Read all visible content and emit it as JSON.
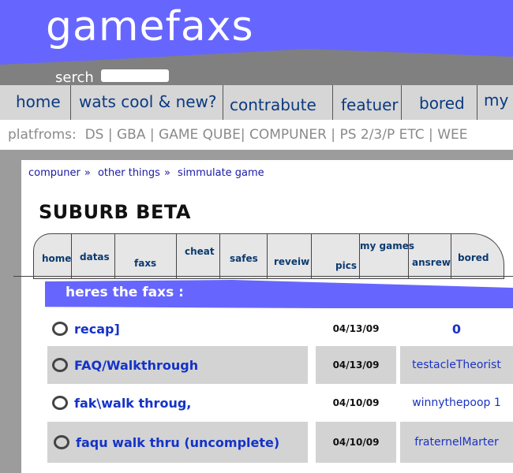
{
  "site": {
    "logo": "gamefaxs",
    "search_label": "serch",
    "search_value": ""
  },
  "nav": {
    "items": [
      {
        "label": "home"
      },
      {
        "label": "wats cool & new?"
      },
      {
        "label": "contrabute"
      },
      {
        "label": "featuer"
      },
      {
        "label": "bored"
      },
      {
        "label": "my"
      }
    ]
  },
  "platforms": {
    "label": "platfroms:",
    "items": [
      "DS",
      "GBA",
      "GAME QUBE",
      "COMPUNER",
      "PS 2/3/P ETC",
      "WEE"
    ]
  },
  "breadcrumb": {
    "items": [
      "compuner",
      "other things",
      "simmulate game"
    ],
    "separator": "»"
  },
  "game": {
    "title": "SUBURB BETA"
  },
  "tabs": [
    {
      "label": "home"
    },
    {
      "label": "datas"
    },
    {
      "label": "faxs"
    },
    {
      "label": "cheat"
    },
    {
      "label": "safes"
    },
    {
      "label": "reveiw"
    },
    {
      "label": "pics"
    },
    {
      "label": "my games"
    },
    {
      "label": "ansrew"
    },
    {
      "label": "bored"
    }
  ],
  "faxs_section": {
    "heading": "heres the faxs  :"
  },
  "faqs": [
    {
      "title": "recap]",
      "date": "04/13/09",
      "author": "0"
    },
    {
      "title": "FAQ/Walkthrough",
      "date": "04/13/09",
      "author": "testacleTheorist"
    },
    {
      "title": "fak\\walk throug,",
      "date": "04/10/09",
      "author": "winnythepoop 1"
    },
    {
      "title": "faqu walk thru (uncomplete)",
      "date": "04/10/09",
      "author": "fraternelMarter"
    }
  ],
  "colors": {
    "brand_blue": "#6666ff",
    "nav_gray": "#d6d6d6",
    "link_blue": "#1433c8"
  }
}
